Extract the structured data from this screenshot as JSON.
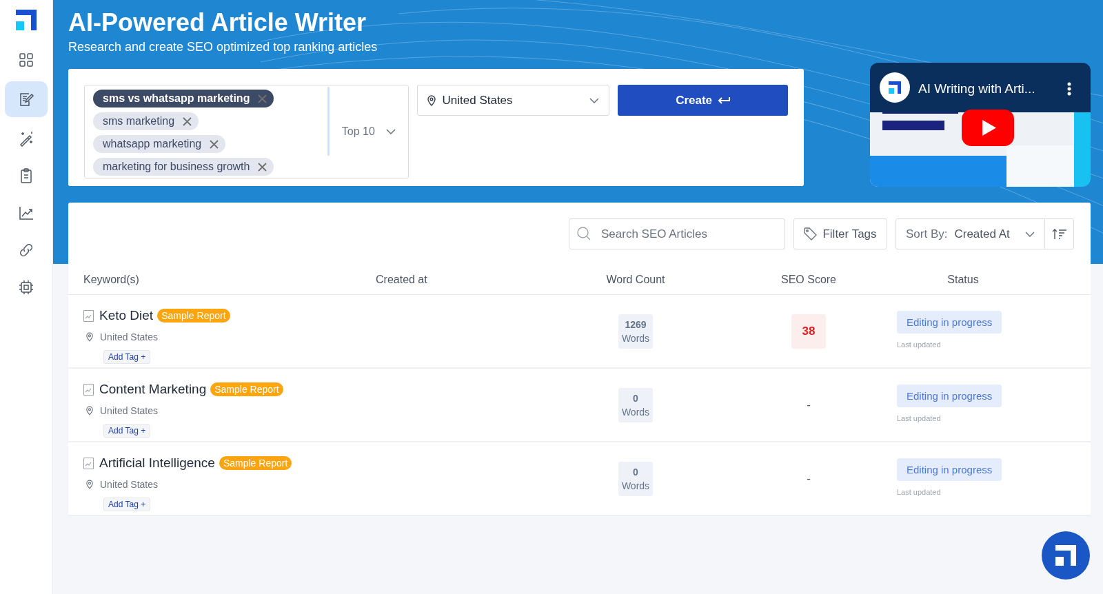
{
  "sidebar": {
    "items": [
      {
        "selected": false
      },
      {
        "selected": true
      },
      {
        "selected": false
      },
      {
        "selected": false
      },
      {
        "selected": false
      },
      {
        "selected": false
      },
      {
        "selected": false
      }
    ]
  },
  "header": {
    "title": "AI-Powered Article Writer",
    "subtitle": "Research and create SEO optimized top ranking articles"
  },
  "form": {
    "keywords": [
      {
        "label": "sms vs whatsapp marketing",
        "selected": true
      },
      {
        "label": "sms marketing",
        "selected": false
      },
      {
        "label": "whatsapp marketing",
        "selected": false
      },
      {
        "label": "marketing for business growth",
        "selected": false
      }
    ],
    "results": "Top 10",
    "location": "United States",
    "create_button": "Create"
  },
  "video": {
    "title": "AI Writing with Arti..."
  },
  "toolbar": {
    "search_placeholder": "Search SEO Articles",
    "filter_button": "Filter Tags",
    "sort_label": "Sort By:",
    "sort_value": "Created At"
  },
  "table": {
    "columns": [
      "Keyword(s)",
      "Created at",
      "Word Count",
      "SEO Score",
      "Status"
    ],
    "rows": [
      {
        "keyword": "Keto Diet",
        "badge": "Sample Report",
        "location": "United States",
        "tag_button": "Add Tag +",
        "words": "1269",
        "words_unit": "Words",
        "seo": {
          "kind": "score",
          "value": "38"
        },
        "status": "Editing in progress",
        "updated": "Last updated"
      },
      {
        "keyword": "Content Marketing",
        "badge": "Sample Report",
        "location": "United States",
        "tag_button": "Add Tag +",
        "words": "0",
        "words_unit": "Words",
        "seo": {
          "kind": "empty",
          "value": "-"
        },
        "status": "Editing in progress",
        "updated": "Last updated"
      },
      {
        "keyword": "Artificial Intelligence",
        "badge": "Sample Report",
        "location": "United States",
        "tag_button": "Add Tag +",
        "words": "0",
        "words_unit": "Words",
        "seo": {
          "kind": "empty",
          "value": "-"
        },
        "status": "Editing in progress",
        "updated": "Last updated"
      }
    ]
  }
}
